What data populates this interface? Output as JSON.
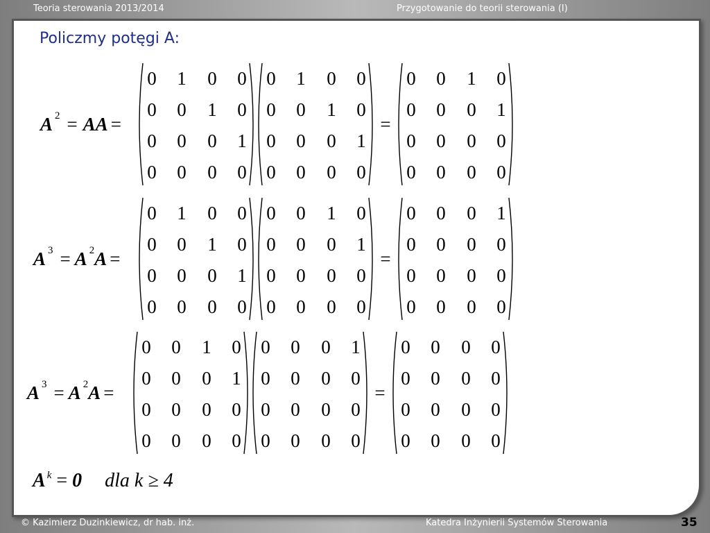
{
  "header": {
    "course": "Teoria sterowania 2013/2014",
    "topic": "Przygotowanie do teorii sterowania (I)"
  },
  "slide": {
    "heading": "Policzmy potęgi A:",
    "equations": [
      {
        "lhs": {
          "base": "A",
          "exp": "2",
          "rhs_prefix": "= ",
          "rhs_terms": [
            {
              "base": "AA",
              "exp": ""
            }
          ],
          "equals_tail": " ="
        },
        "left": [
          [
            "0",
            "1",
            "0",
            "0"
          ],
          [
            "0",
            "0",
            "1",
            "0"
          ],
          [
            "0",
            "0",
            "0",
            "1"
          ],
          [
            "0",
            "0",
            "0",
            "0"
          ]
        ],
        "right": [
          [
            "0",
            "1",
            "0",
            "0"
          ],
          [
            "0",
            "0",
            "1",
            "0"
          ],
          [
            "0",
            "0",
            "0",
            "1"
          ],
          [
            "0",
            "0",
            "0",
            "0"
          ]
        ],
        "equals": "=",
        "result": [
          [
            "0",
            "0",
            "1",
            "0"
          ],
          [
            "0",
            "0",
            "0",
            "1"
          ],
          [
            "0",
            "0",
            "0",
            "0"
          ],
          [
            "0",
            "0",
            "0",
            "0"
          ]
        ]
      },
      {
        "lhs": {
          "base": "A",
          "exp": "3",
          "rhs_prefix": "= ",
          "rhs_terms": [
            {
              "base": "A",
              "exp": "2"
            },
            {
              "base": "A",
              "exp": ""
            }
          ],
          "equals_tail": " ="
        },
        "left": [
          [
            "0",
            "1",
            "0",
            "0"
          ],
          [
            "0",
            "0",
            "1",
            "0"
          ],
          [
            "0",
            "0",
            "0",
            "1"
          ],
          [
            "0",
            "0",
            "0",
            "0"
          ]
        ],
        "right": [
          [
            "0",
            "0",
            "1",
            "0"
          ],
          [
            "0",
            "0",
            "0",
            "1"
          ],
          [
            "0",
            "0",
            "0",
            "0"
          ],
          [
            "0",
            "0",
            "0",
            "0"
          ]
        ],
        "equals": "=",
        "result": [
          [
            "0",
            "0",
            "0",
            "1"
          ],
          [
            "0",
            "0",
            "0",
            "0"
          ],
          [
            "0",
            "0",
            "0",
            "0"
          ],
          [
            "0",
            "0",
            "0",
            "0"
          ]
        ]
      },
      {
        "lhs": {
          "base": "A",
          "exp": "3",
          "rhs_prefix": "= ",
          "rhs_terms": [
            {
              "base": "A",
              "exp": "2"
            },
            {
              "base": "A",
              "exp": ""
            }
          ],
          "equals_tail": " ="
        },
        "left": [
          [
            "0",
            "0",
            "1",
            "0"
          ],
          [
            "0",
            "0",
            "0",
            "1"
          ],
          [
            "0",
            "0",
            "0",
            "0"
          ],
          [
            "0",
            "0",
            "0",
            "0"
          ]
        ],
        "right": [
          [
            "0",
            "0",
            "0",
            "1"
          ],
          [
            "0",
            "0",
            "0",
            "0"
          ],
          [
            "0",
            "0",
            "0",
            "0"
          ],
          [
            "0",
            "0",
            "0",
            "0"
          ]
        ],
        "equals": "=",
        "result": [
          [
            "0",
            "0",
            "0",
            "0"
          ],
          [
            "0",
            "0",
            "0",
            "0"
          ],
          [
            "0",
            "0",
            "0",
            "0"
          ],
          [
            "0",
            "0",
            "0",
            "0"
          ]
        ]
      }
    ],
    "final": {
      "base": "A",
      "exp": "k",
      "eq": " = ",
      "zero": "0",
      "text": "dla k ≥ 4"
    }
  },
  "footer": {
    "author": "© Kazimierz Duzinkiewicz, dr hab. inż.",
    "department": "Katedra Inżynierii Systemów Sterowania",
    "page": "35"
  }
}
